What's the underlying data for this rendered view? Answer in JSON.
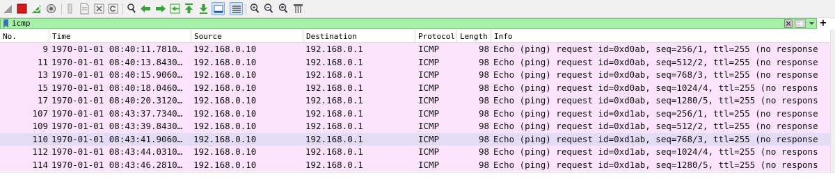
{
  "toolbar": {
    "icons": [
      "shark-fin-icon",
      "stop-icon",
      "restart-icon",
      "options-icon",
      "open-file-icon",
      "save-file-icon",
      "close-file-icon",
      "reload-icon",
      "find-icon",
      "go-back-icon",
      "go-forward-icon",
      "go-to-packet-icon",
      "first-packet-icon",
      "last-packet-icon",
      "autoscroll-icon",
      "colorize-icon",
      "zoom-in-icon",
      "zoom-out-icon",
      "normal-size-icon",
      "resize-columns-icon"
    ]
  },
  "filter": {
    "value": "icmp",
    "plus_label": "+"
  },
  "columns": {
    "no": "No.",
    "time": "Time",
    "source": "Source",
    "destination": "Destination",
    "protocol": "Protocol",
    "length": "Length",
    "info": "Info"
  },
  "packets": [
    {
      "no": "9",
      "time": "1970-01-01 08:40:11.7810…",
      "source": "192.168.0.10",
      "destination": "192.168.0.1",
      "protocol": "ICMP",
      "length": "98",
      "info": "Echo (ping) request  id=0xd0ab, seq=256/1, ttl=255 (no response"
    },
    {
      "no": "11",
      "time": "1970-01-01 08:40:13.8430…",
      "source": "192.168.0.10",
      "destination": "192.168.0.1",
      "protocol": "ICMP",
      "length": "98",
      "info": "Echo (ping) request  id=0xd0ab, seq=512/2, ttl=255 (no response"
    },
    {
      "no": "13",
      "time": "1970-01-01 08:40:15.9060…",
      "source": "192.168.0.10",
      "destination": "192.168.0.1",
      "protocol": "ICMP",
      "length": "98",
      "info": "Echo (ping) request  id=0xd0ab, seq=768/3, ttl=255 (no response"
    },
    {
      "no": "15",
      "time": "1970-01-01 08:40:18.0460…",
      "source": "192.168.0.10",
      "destination": "192.168.0.1",
      "protocol": "ICMP",
      "length": "98",
      "info": "Echo (ping) request  id=0xd0ab, seq=1024/4, ttl=255 (no respons"
    },
    {
      "no": "17",
      "time": "1970-01-01 08:40:20.3120…",
      "source": "192.168.0.10",
      "destination": "192.168.0.1",
      "protocol": "ICMP",
      "length": "98",
      "info": "Echo (ping) request  id=0xd0ab, seq=1280/5, ttl=255 (no respons"
    },
    {
      "no": "107",
      "time": "1970-01-01 08:43:37.7340…",
      "source": "192.168.0.10",
      "destination": "192.168.0.1",
      "protocol": "ICMP",
      "length": "98",
      "info": "Echo (ping) request  id=0xd1ab, seq=256/1, ttl=255 (no response"
    },
    {
      "no": "109",
      "time": "1970-01-01 08:43:39.8430…",
      "source": "192.168.0.10",
      "destination": "192.168.0.1",
      "protocol": "ICMP",
      "length": "98",
      "info": "Echo (ping) request  id=0xd1ab, seq=512/2, ttl=255 (no response"
    },
    {
      "no": "110",
      "time": "1970-01-01 08:43:41.9060…",
      "source": "192.168.0.10",
      "destination": "192.168.0.1",
      "protocol": "ICMP",
      "length": "98",
      "info": "Echo (ping) request  id=0xd1ab, seq=768/3, ttl=255 (no response",
      "selected": true
    },
    {
      "no": "112",
      "time": "1970-01-01 08:43:44.0310…",
      "source": "192.168.0.10",
      "destination": "192.168.0.1",
      "protocol": "ICMP",
      "length": "98",
      "info": "Echo (ping) request  id=0xd1ab, seq=1024/4, ttl=255 (no respons"
    },
    {
      "no": "114",
      "time": "1970-01-01 08:43:46.2810…",
      "source": "192.168.0.10",
      "destination": "192.168.0.1",
      "protocol": "ICMP",
      "length": "98",
      "info": "Echo (ping) request  id=0xd1ab, seq=1280/5, ttl=255 (no respons"
    }
  ],
  "colors": {
    "row_bg": "#fbe3fb",
    "selected_row_bg": "#e3dcf7",
    "filter_valid_bg": "#a5f1a5"
  }
}
